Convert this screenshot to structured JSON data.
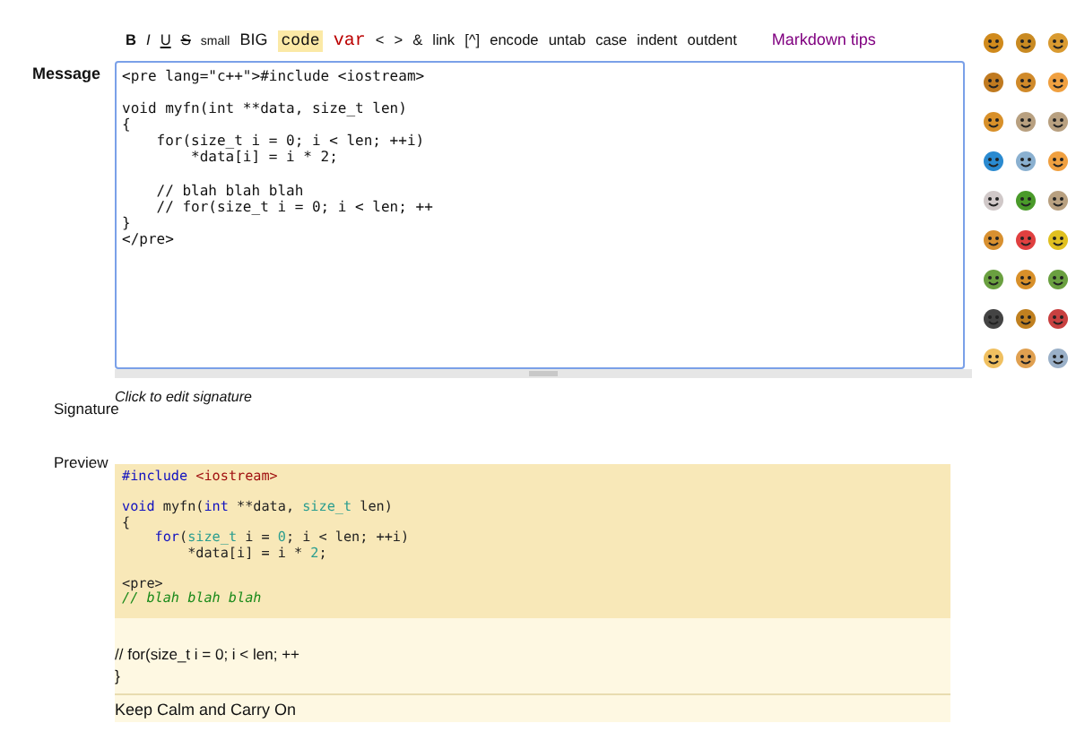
{
  "toolbar": [
    {
      "label": "B",
      "kind": "bold"
    },
    {
      "label": "I",
      "kind": "italic"
    },
    {
      "label": "U",
      "kind": "underline"
    },
    {
      "label": "S",
      "kind": "strike"
    },
    {
      "label": "small",
      "kind": "small"
    },
    {
      "label": "BIG",
      "kind": "big"
    },
    {
      "label": "code",
      "kind": "code"
    },
    {
      "label": "var",
      "kind": "var"
    },
    {
      "label": "<",
      "kind": "plain"
    },
    {
      "label": ">",
      "kind": "plain"
    },
    {
      "label": "&",
      "kind": "plain"
    },
    {
      "label": "link",
      "kind": "plain"
    },
    {
      "label": "[^]",
      "kind": "plain"
    },
    {
      "label": "encode",
      "kind": "plain"
    },
    {
      "label": "untab",
      "kind": "plain"
    },
    {
      "label": "case",
      "kind": "plain"
    },
    {
      "label": "indent",
      "kind": "plain"
    },
    {
      "label": "outdent",
      "kind": "plain"
    }
  ],
  "markdown_link": "Markdown tips",
  "message": {
    "label": "Message",
    "value": "<pre lang=\"c++\">#include <iostream>\n\nvoid myfn(int **data, size_t len)\n{\n    for(size_t i = 0; i < len; ++i)\n        *data[i] = i * 2;\n\n    // blah blah blah\n    // for(size_t i = 0; i < len; ++\n}\n</pre>"
  },
  "signature": {
    "label": "Signature",
    "hint": "Click to edit signature"
  },
  "preview": {
    "label": "Preview",
    "code": [
      {
        "blank_before": false,
        "tokens": [
          {
            "text": "#include ",
            "kind": "keyword"
          },
          {
            "text": "<iostream>",
            "kind": "string"
          }
        ]
      },
      {
        "blank_before": true,
        "tokens": [
          {
            "text": "void",
            "kind": "keyword"
          },
          {
            "text": " myfn(",
            "kind": "plain"
          },
          {
            "text": "int",
            "kind": "keyword"
          },
          {
            "text": " **data, ",
            "kind": "plain"
          },
          {
            "text": "size_t",
            "kind": "type"
          },
          {
            "text": " len)",
            "kind": "plain"
          }
        ]
      },
      {
        "blank_before": false,
        "tokens": [
          {
            "text": "{",
            "kind": "plain"
          }
        ]
      },
      {
        "blank_before": false,
        "tokens": [
          {
            "text": "    for",
            "kind": "keyword"
          },
          {
            "text": "(",
            "kind": "plain"
          },
          {
            "text": "size_t",
            "kind": "type"
          },
          {
            "text": " i = ",
            "kind": "plain"
          },
          {
            "text": "0",
            "kind": "number"
          },
          {
            "text": "; i < len; ++i)",
            "kind": "plain"
          }
        ]
      },
      {
        "blank_before": false,
        "tokens": [
          {
            "text": "        *data[i] = i * ",
            "kind": "plain"
          },
          {
            "text": "2",
            "kind": "number"
          },
          {
            "text": ";",
            "kind": "plain"
          }
        ]
      },
      {
        "blank_before": true,
        "tokens": [
          {
            "text": "<pre>",
            "kind": "plain"
          }
        ]
      },
      {
        "blank_before": false,
        "tokens": [
          {
            "text": "// blah blah blah",
            "kind": "comment"
          }
        ]
      }
    ],
    "text": [
      "// for(size_t i = 0; i < len; ++",
      "}"
    ],
    "footer": "Keep Calm and Carry On"
  }
}
